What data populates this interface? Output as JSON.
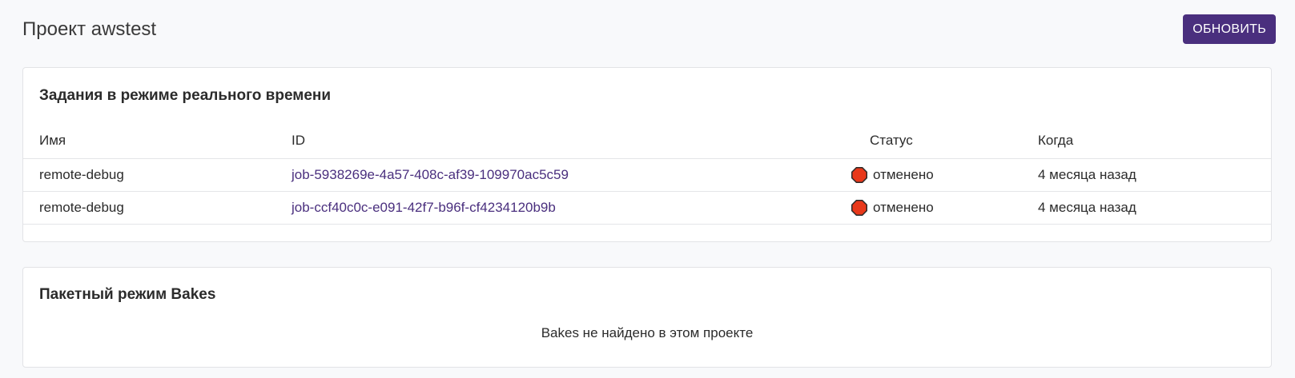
{
  "header": {
    "title": "Проект awstest",
    "refresh_label": "ОБНОВИТЬ",
    "refresh_color": "#4a2f7e"
  },
  "realtime": {
    "title": "Задания в режиме реального времени",
    "columns": {
      "name": "Имя",
      "id": "ID",
      "status": "Статус",
      "when": "Когда"
    },
    "rows": [
      {
        "name": "remote-debug",
        "id": "job-5938269e-4a57-408c-af39-109970ac5c59",
        "status": "отменено",
        "status_icon": "stop-icon",
        "when": "4 месяца назад"
      },
      {
        "name": "remote-debug",
        "id": "job-ccf40c0c-e091-42f7-b96f-cf4234120b9b",
        "status": "отменено",
        "status_icon": "stop-icon",
        "when": "4 месяца назад"
      }
    ]
  },
  "bakes": {
    "title": "Пакетный режим Bakes",
    "empty_message": "Bakes не найдено в этом проекте"
  },
  "colors": {
    "accent": "#4a2f7e",
    "stop_fill": "#e8381a",
    "stop_border": "#2a2a2a"
  }
}
